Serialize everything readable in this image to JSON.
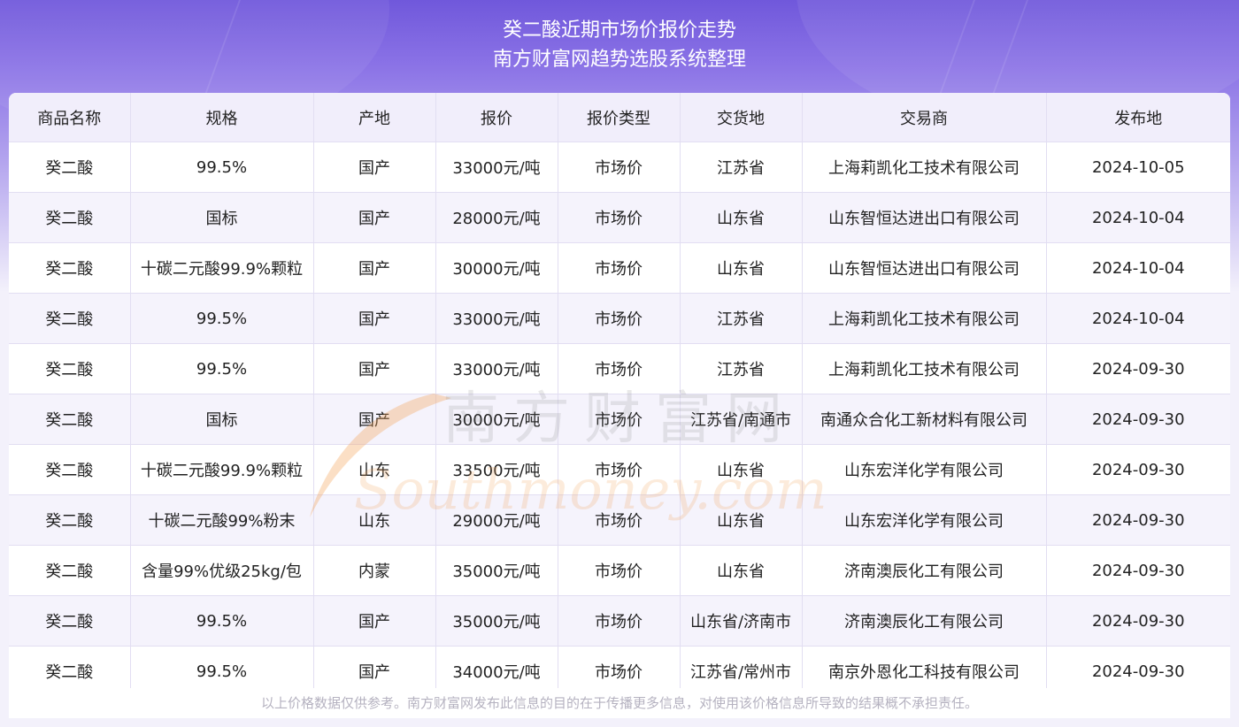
{
  "header": {
    "title": "癸二酸近期市场价报价走势",
    "subtitle": "南方财富网趋势选股系统整理"
  },
  "table": {
    "columns": [
      "商品名称",
      "规格",
      "产地",
      "报价",
      "报价类型",
      "交货地",
      "交易商",
      "发布地"
    ],
    "rows": [
      [
        "癸二酸",
        "99.5%",
        "国产",
        "33000元/吨",
        "市场价",
        "江苏省",
        "上海莉凯化工技术有限公司",
        "2024-10-05"
      ],
      [
        "癸二酸",
        "国标",
        "国产",
        "28000元/吨",
        "市场价",
        "山东省",
        "山东智恒达进出口有限公司",
        "2024-10-04"
      ],
      [
        "癸二酸",
        "十碳二元酸99.9%颗粒",
        "国产",
        "30000元/吨",
        "市场价",
        "山东省",
        "山东智恒达进出口有限公司",
        "2024-10-04"
      ],
      [
        "癸二酸",
        "99.5%",
        "国产",
        "33000元/吨",
        "市场价",
        "江苏省",
        "上海莉凯化工技术有限公司",
        "2024-10-04"
      ],
      [
        "癸二酸",
        "99.5%",
        "国产",
        "33000元/吨",
        "市场价",
        "江苏省",
        "上海莉凯化工技术有限公司",
        "2024-09-30"
      ],
      [
        "癸二酸",
        "国标",
        "国产",
        "30000元/吨",
        "市场价",
        "江苏省/南通市",
        "南通众合化工新材料有限公司",
        "2024-09-30"
      ],
      [
        "癸二酸",
        "十碳二元酸99.9%颗粒",
        "山东",
        "33500元/吨",
        "市场价",
        "山东省",
        "山东宏洋化学有限公司",
        "2024-09-30"
      ],
      [
        "癸二酸",
        "十碳二元酸99%粉末",
        "山东",
        "29000元/吨",
        "市场价",
        "山东省",
        "山东宏洋化学有限公司",
        "2024-09-30"
      ],
      [
        "癸二酸",
        "含量99%优级25kg/包",
        "内蒙",
        "35000元/吨",
        "市场价",
        "山东省",
        "济南澳辰化工有限公司",
        "2024-09-30"
      ],
      [
        "癸二酸",
        "99.5%",
        "国产",
        "35000元/吨",
        "市场价",
        "山东省/济南市",
        "济南澳辰化工有限公司",
        "2024-09-30"
      ],
      [
        "癸二酸",
        "99.5%",
        "国产",
        "34000元/吨",
        "市场价",
        "江苏省/常州市",
        "南京外恩化工科技有限公司",
        "2024-09-30"
      ]
    ]
  },
  "watermark": {
    "cn": "南方财富网",
    "en": "Southmoney.com"
  },
  "footer": {
    "disclaimer": "以上价格数据仅供参考。南方财富网发布此信息的目的在于传播更多信息，对使用该价格信息所导致的结果概不承担责任。"
  },
  "colors": {
    "banner_top": "#7058db",
    "header_row_bg": "#f1eefb",
    "stripe_bg": "#f5f3fc",
    "watermark_orange": "#f3a35a"
  }
}
